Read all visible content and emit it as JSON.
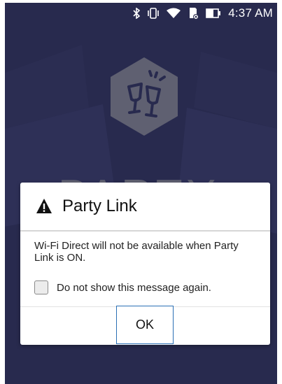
{
  "status_bar": {
    "icons": [
      "bluetooth-icon",
      "vibrate-icon",
      "wifi-icon",
      "sd-card-icon",
      "battery-icon"
    ],
    "time": "4:37 AM"
  },
  "background": {
    "app_word": "PARTY",
    "logo": "party-link-logo"
  },
  "dialog": {
    "icon": "warning-icon",
    "title": "Party Link",
    "message": "Wi-Fi Direct will not be available when Party Link is ON.",
    "checkbox_label": "Do not show this message again.",
    "checkbox_checked": false,
    "ok_label": "OK"
  },
  "colors": {
    "background": "#282a4e",
    "dialog": "#ffffff",
    "ok_border": "#2a6fb5"
  }
}
